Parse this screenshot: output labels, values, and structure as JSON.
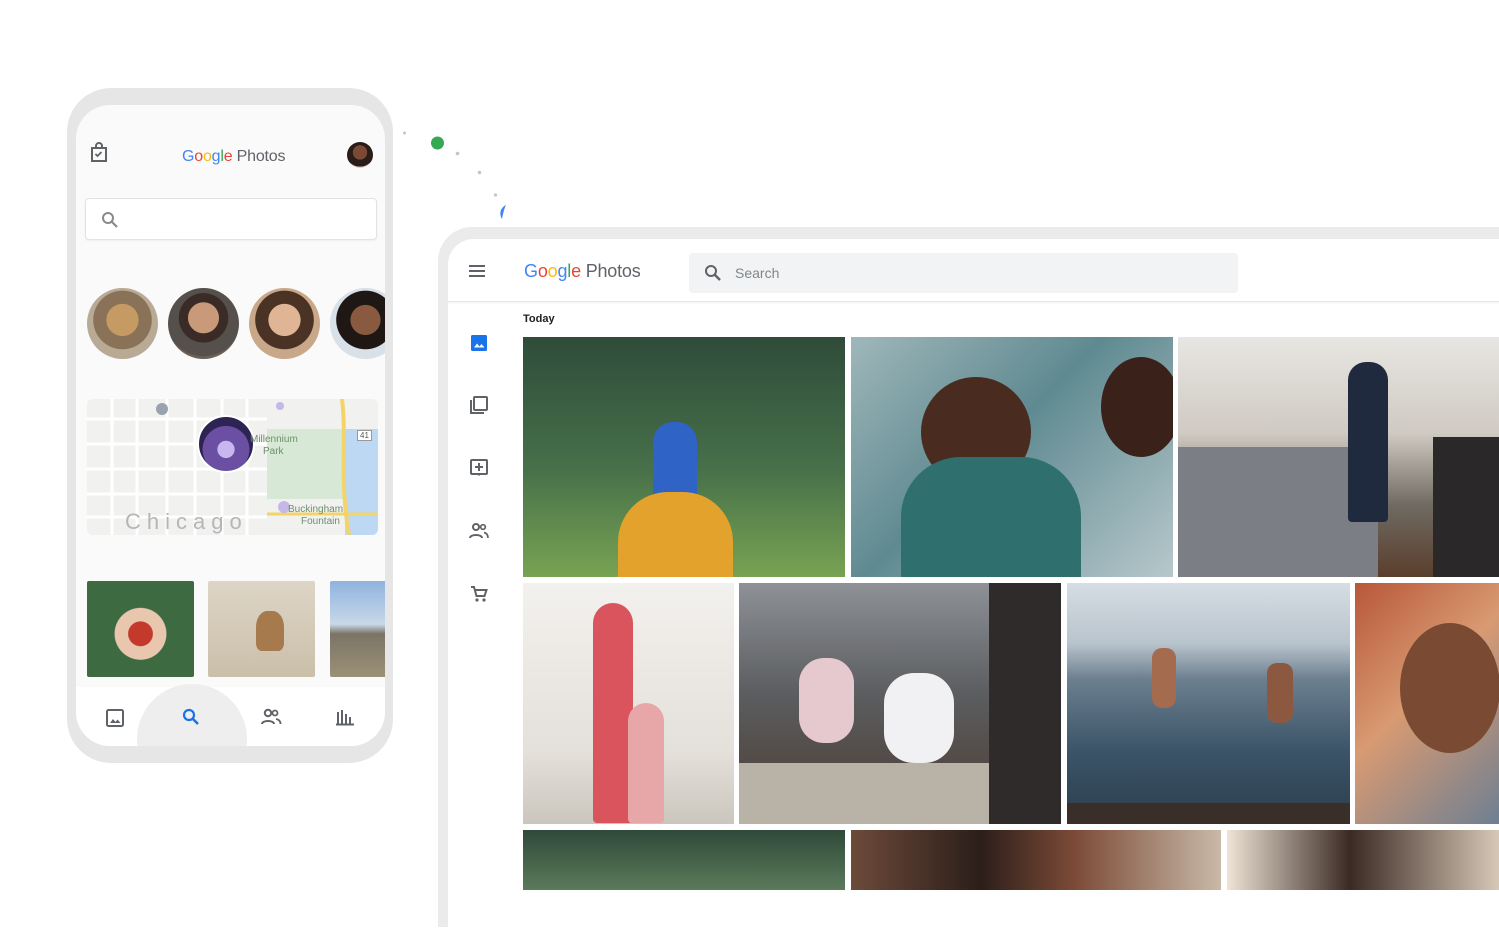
{
  "phone": {
    "logo": {
      "g1": "G",
      "g2": "o",
      "g3": "o",
      "g4": "g",
      "g5": "l",
      "g6": "e",
      "product": "Photos"
    },
    "map": {
      "label_city": "Chicago",
      "label_park1": "Millennium",
      "label_park2": "Park",
      "label_fountain1": "Buckingham",
      "label_fountain2": "Fountain",
      "route_number": "41"
    },
    "nav_items": [
      "photos-icon",
      "search-icon",
      "sharing-icon",
      "library-icon"
    ],
    "active_nav": "search"
  },
  "desktop": {
    "logo": {
      "g1": "G",
      "g2": "o",
      "g3": "o",
      "g4": "g",
      "g5": "l",
      "g6": "e",
      "product": "Photos"
    },
    "search": {
      "placeholder": "Search"
    },
    "section_label": "Today",
    "sidebar_items": [
      "photos-icon",
      "albums-icon",
      "utilities-icon",
      "sharing-icon",
      "print-store-icon"
    ]
  },
  "colors": {
    "accent": "#1a73e8",
    "green_dot": "#34a853",
    "blue_dot": "#4285f4",
    "frame": "#e6e6e6"
  }
}
